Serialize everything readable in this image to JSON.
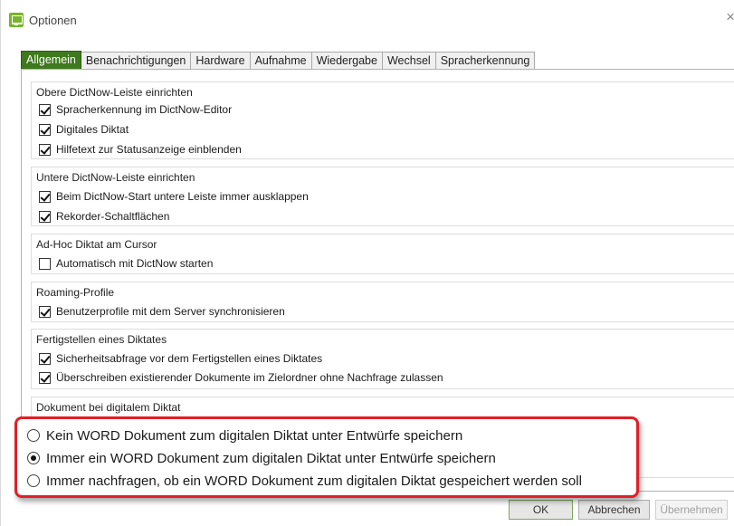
{
  "window": {
    "title": "Optionen",
    "close_glyph": "×"
  },
  "tabs": [
    {
      "label": "Allgemein",
      "active": true
    },
    {
      "label": "Benachrichtigungen",
      "active": false
    },
    {
      "label": "Hardware",
      "active": false
    },
    {
      "label": "Aufnahme",
      "active": false
    },
    {
      "label": "Wiedergabe",
      "active": false
    },
    {
      "label": "Wechsel",
      "active": false
    },
    {
      "label": "Spracherkennung",
      "active": false
    }
  ],
  "groups": {
    "obere": {
      "title": "Obere DictNow-Leiste einrichten",
      "items": [
        {
          "label": "Spracherkennung im DictNow-Editor",
          "checked": true
        },
        {
          "label": "Digitales Diktat",
          "checked": true
        },
        {
          "label": "Hilfetext zur Statusanzeige einblenden",
          "checked": true
        }
      ]
    },
    "untere": {
      "title": "Untere DictNow-Leiste einrichten",
      "items": [
        {
          "label": "Beim DictNow-Start untere Leiste immer ausklappen",
          "checked": true
        },
        {
          "label": "Rekorder-Schaltflächen",
          "checked": true
        }
      ]
    },
    "adhoc": {
      "title": "Ad-Hoc Diktat am Cursor",
      "items": [
        {
          "label": "Automatisch mit DictNow starten",
          "checked": false
        }
      ]
    },
    "roaming": {
      "title": "Roaming-Profile",
      "items": [
        {
          "label": "Benutzerprofile mit dem Server synchronisieren",
          "checked": true
        }
      ]
    },
    "fertig": {
      "title": "Fertigstellen eines Diktates",
      "items": [
        {
          "label": "Sicherheitsabfrage vor dem Fertigstellen eines Diktates",
          "checked": true
        },
        {
          "label": "Überschreiben existierender Dokumente im Zielordner ohne Nachfrage zulassen",
          "checked": true
        }
      ]
    },
    "dokument": {
      "title": "Dokument bei digitalem Diktat"
    }
  },
  "callout": {
    "options": [
      {
        "label": "Kein WORD Dokument zum digitalen Diktat unter Entwürfe speichern",
        "selected": false
      },
      {
        "label": "Immer ein WORD Dokument zum digitalen Diktat unter Entwürfe speichern",
        "selected": true
      },
      {
        "label": "Immer nachfragen, ob ein WORD Dokument zum digitalen Diktat gespeichert werden soll",
        "selected": false
      }
    ],
    "border_color": "#e11f26"
  },
  "buttons": {
    "ok": "OK",
    "cancel": "Abbrechen",
    "apply": "Übernehmen"
  },
  "colors": {
    "active_tab": "#3e7a1d",
    "app_icon": "#78b52a"
  }
}
